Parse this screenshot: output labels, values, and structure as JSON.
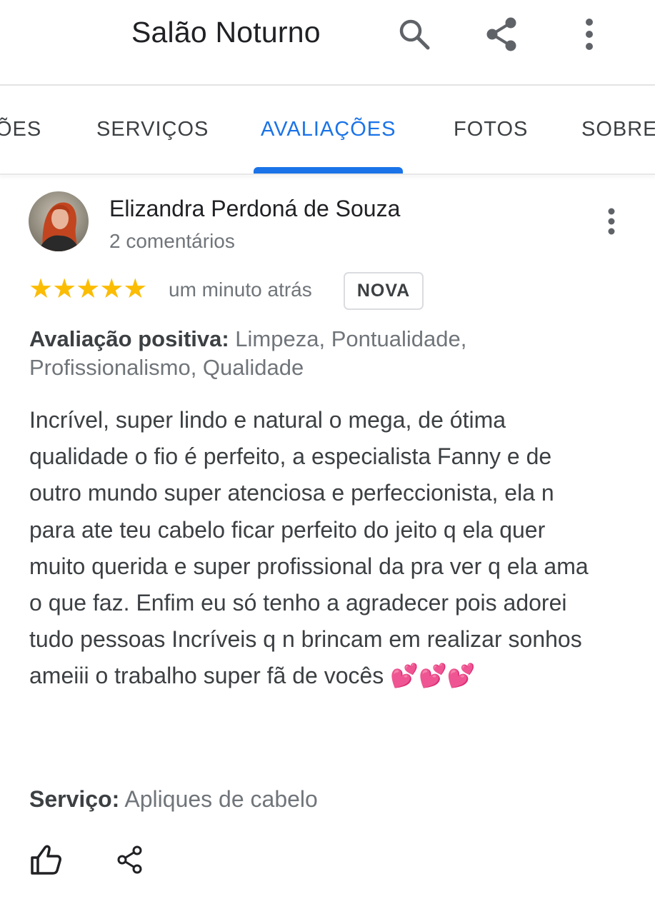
{
  "header": {
    "title": "Salão Noturno",
    "icons": [
      "search-icon",
      "share-icon",
      "more-vert-icon"
    ]
  },
  "tabs": [
    {
      "label": "ÕES",
      "active": false
    },
    {
      "label": "SERVIÇOS",
      "active": false
    },
    {
      "label": "AVALIAÇÕES",
      "active": true
    },
    {
      "label": "FOTOS",
      "active": false
    },
    {
      "label": "SOBRE",
      "active": false
    }
  ],
  "review": {
    "author": "Elizandra Perdoná de Souza",
    "comments": "2 comentários",
    "stars": "★★★★★",
    "rating": 5,
    "time": "um minuto atrás",
    "badge": "NOVA",
    "positive_label": "Avaliação positiva:",
    "positive_line1": " Limpeza, Pontualidade,",
    "positive_line2": " Profissionalismo, Qualidade",
    "text": "Incrível, super lindo e natural o mega, de ótima qualidade o fio é perfeito, a especialista Fanny e de outro mundo super atenciosa e perfeccionista, ela n para ate teu cabelo ficar perfeito do jeito q ela quer muito querida e super profissional da pra ver q ela ama o que faz. Enfim eu só tenho a agradecer pois adorei tudo pessoas Incríveis q n brincam em realizar sonhos ameiii o trabalho super fã de vocês 💕💕💕",
    "service_label": "Serviço:",
    "service_value": " Apliques de cabelo"
  },
  "colors": {
    "accent": "#1a73e8",
    "star": "#fbbc04",
    "heart": "#e8388a"
  }
}
